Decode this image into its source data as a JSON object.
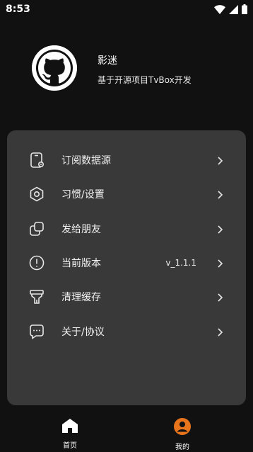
{
  "status_bar": {
    "time": "8:53",
    "icons": [
      "wifi-icon",
      "signal-icon",
      "battery-icon"
    ]
  },
  "profile": {
    "name": "影迷",
    "description": "基于开源项目TvBox开发",
    "avatar_icon": "github-icon"
  },
  "menu": {
    "items": [
      {
        "label": "订阅数据源",
        "icon": "subscription-icon",
        "value": ""
      },
      {
        "label": "习惯/设置",
        "icon": "settings-icon",
        "value": ""
      },
      {
        "label": "发给朋友",
        "icon": "share-icon",
        "value": ""
      },
      {
        "label": "当前版本",
        "icon": "info-icon",
        "value": "v_1.1.1"
      },
      {
        "label": "清理缓存",
        "icon": "clean-icon",
        "value": ""
      },
      {
        "label": "关于/协议",
        "icon": "about-icon",
        "value": ""
      }
    ]
  },
  "bottom_nav": {
    "items": [
      {
        "label": "首页",
        "icon": "home-icon",
        "active": false
      },
      {
        "label": "我的",
        "icon": "profile-icon",
        "active": true
      }
    ]
  },
  "colors": {
    "background": "#111111",
    "card": "#393939",
    "accent": "#e8741c",
    "text": "#ffffff"
  }
}
